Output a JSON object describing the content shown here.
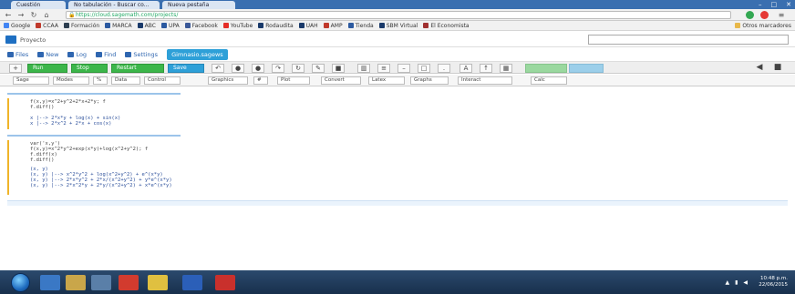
{
  "browser": {
    "tabs": [
      {
        "label": "Cuestión"
      },
      {
        "label": "No tabulación - Buscar co..."
      },
      {
        "label": "Nueva pestaña"
      }
    ],
    "url": "https://cloud.sagemath.com/projects/",
    "bookmarks": [
      {
        "label": "Google"
      },
      {
        "label": "CCAA"
      },
      {
        "label": "Formación"
      },
      {
        "label": "MARCA"
      },
      {
        "label": "ABC"
      },
      {
        "label": "UPA"
      },
      {
        "label": "Facebook"
      },
      {
        "label": "YouTube"
      },
      {
        "label": "Rodaudita"
      },
      {
        "label": "UAH"
      },
      {
        "label": "AMP"
      },
      {
        "label": "Tienda"
      },
      {
        "label": "SBM Virtual"
      },
      {
        "label": "El Economista"
      },
      {
        "label": "Otros marcadores"
      }
    ]
  },
  "app": {
    "project_label": "Proyecto",
    "search_placeholder": "",
    "menu": [
      {
        "label": "Files"
      },
      {
        "label": "New"
      },
      {
        "label": "Log"
      },
      {
        "label": "Find"
      },
      {
        "label": "Settings"
      },
      {
        "label": "Gimnasio.sagews"
      }
    ],
    "toolbar": {
      "run_label": "Run",
      "stop_label": "Stop",
      "restart_label": "Restart",
      "save_label": "Save"
    },
    "dropdowns": [
      {
        "label": "Sage"
      },
      {
        "label": "Modes"
      },
      {
        "label": "%"
      },
      {
        "label": "Data"
      },
      {
        "label": "Control"
      },
      {
        "label": "Graphics"
      },
      {
        "label": "#"
      },
      {
        "label": "Plot"
      },
      {
        "label": "Convert"
      },
      {
        "label": "Latex"
      },
      {
        "label": "Graphs"
      },
      {
        "label": "Interact"
      },
      {
        "label": "Calc"
      }
    ]
  },
  "cells": [
    {
      "code": [
        "f(x,y)=x^2+y^2+2*x+2*y; f",
        "f.diff()",
        "",
        "x |--> 2*x*y + log(x) + sin(x)",
        "x |--> 2*x^2 + 2*x + cos(x)"
      ]
    },
    {
      "code": [
        "var('x,y')",
        "f(x,y)=x^2*y^2+exp(x*y)+log(x^2+y^2); f",
        "f.diff(x)",
        "f.diff()",
        "",
        "(x, y)",
        "(x, y) |--> x^2*y^2 + log(x^2+y^2) + e^(x*y)",
        "(x, y) |--> 2*x*y^2 + 2*x/(x^2+y^2) + y*e^(x*y)",
        "(x, y) |--> 2*x^2*y + 2*y/(x^2+y^2) + x*e^(x*y)"
      ]
    }
  ],
  "taskbar": {
    "time": "10:48 p.m.",
    "date": "22/06/2015"
  }
}
